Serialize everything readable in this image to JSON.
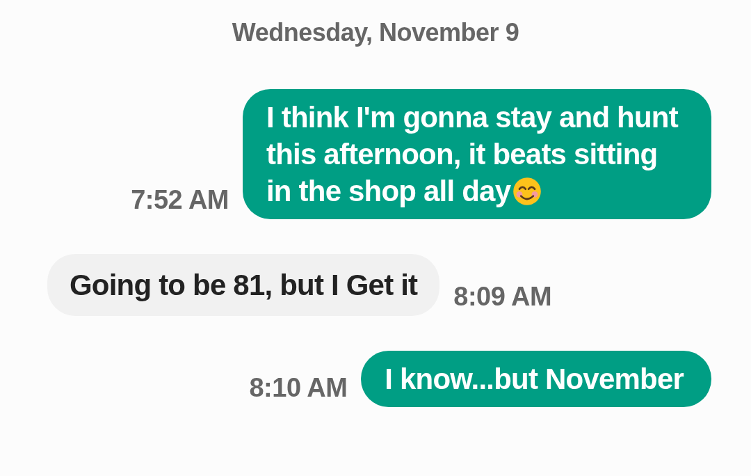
{
  "date_header": "Wednesday, November 9",
  "messages": [
    {
      "kind": "sent",
      "text": "I think I'm gonna stay and hunt this afternoon, it beats sitting in the shop all day",
      "smiley": true,
      "time": "7:52 AM"
    },
    {
      "kind": "received",
      "text": "Going to be 81, but I Get it",
      "time": "8:09 AM"
    },
    {
      "kind": "sent",
      "text": "I know...but November",
      "time": "8:10 AM"
    }
  ]
}
